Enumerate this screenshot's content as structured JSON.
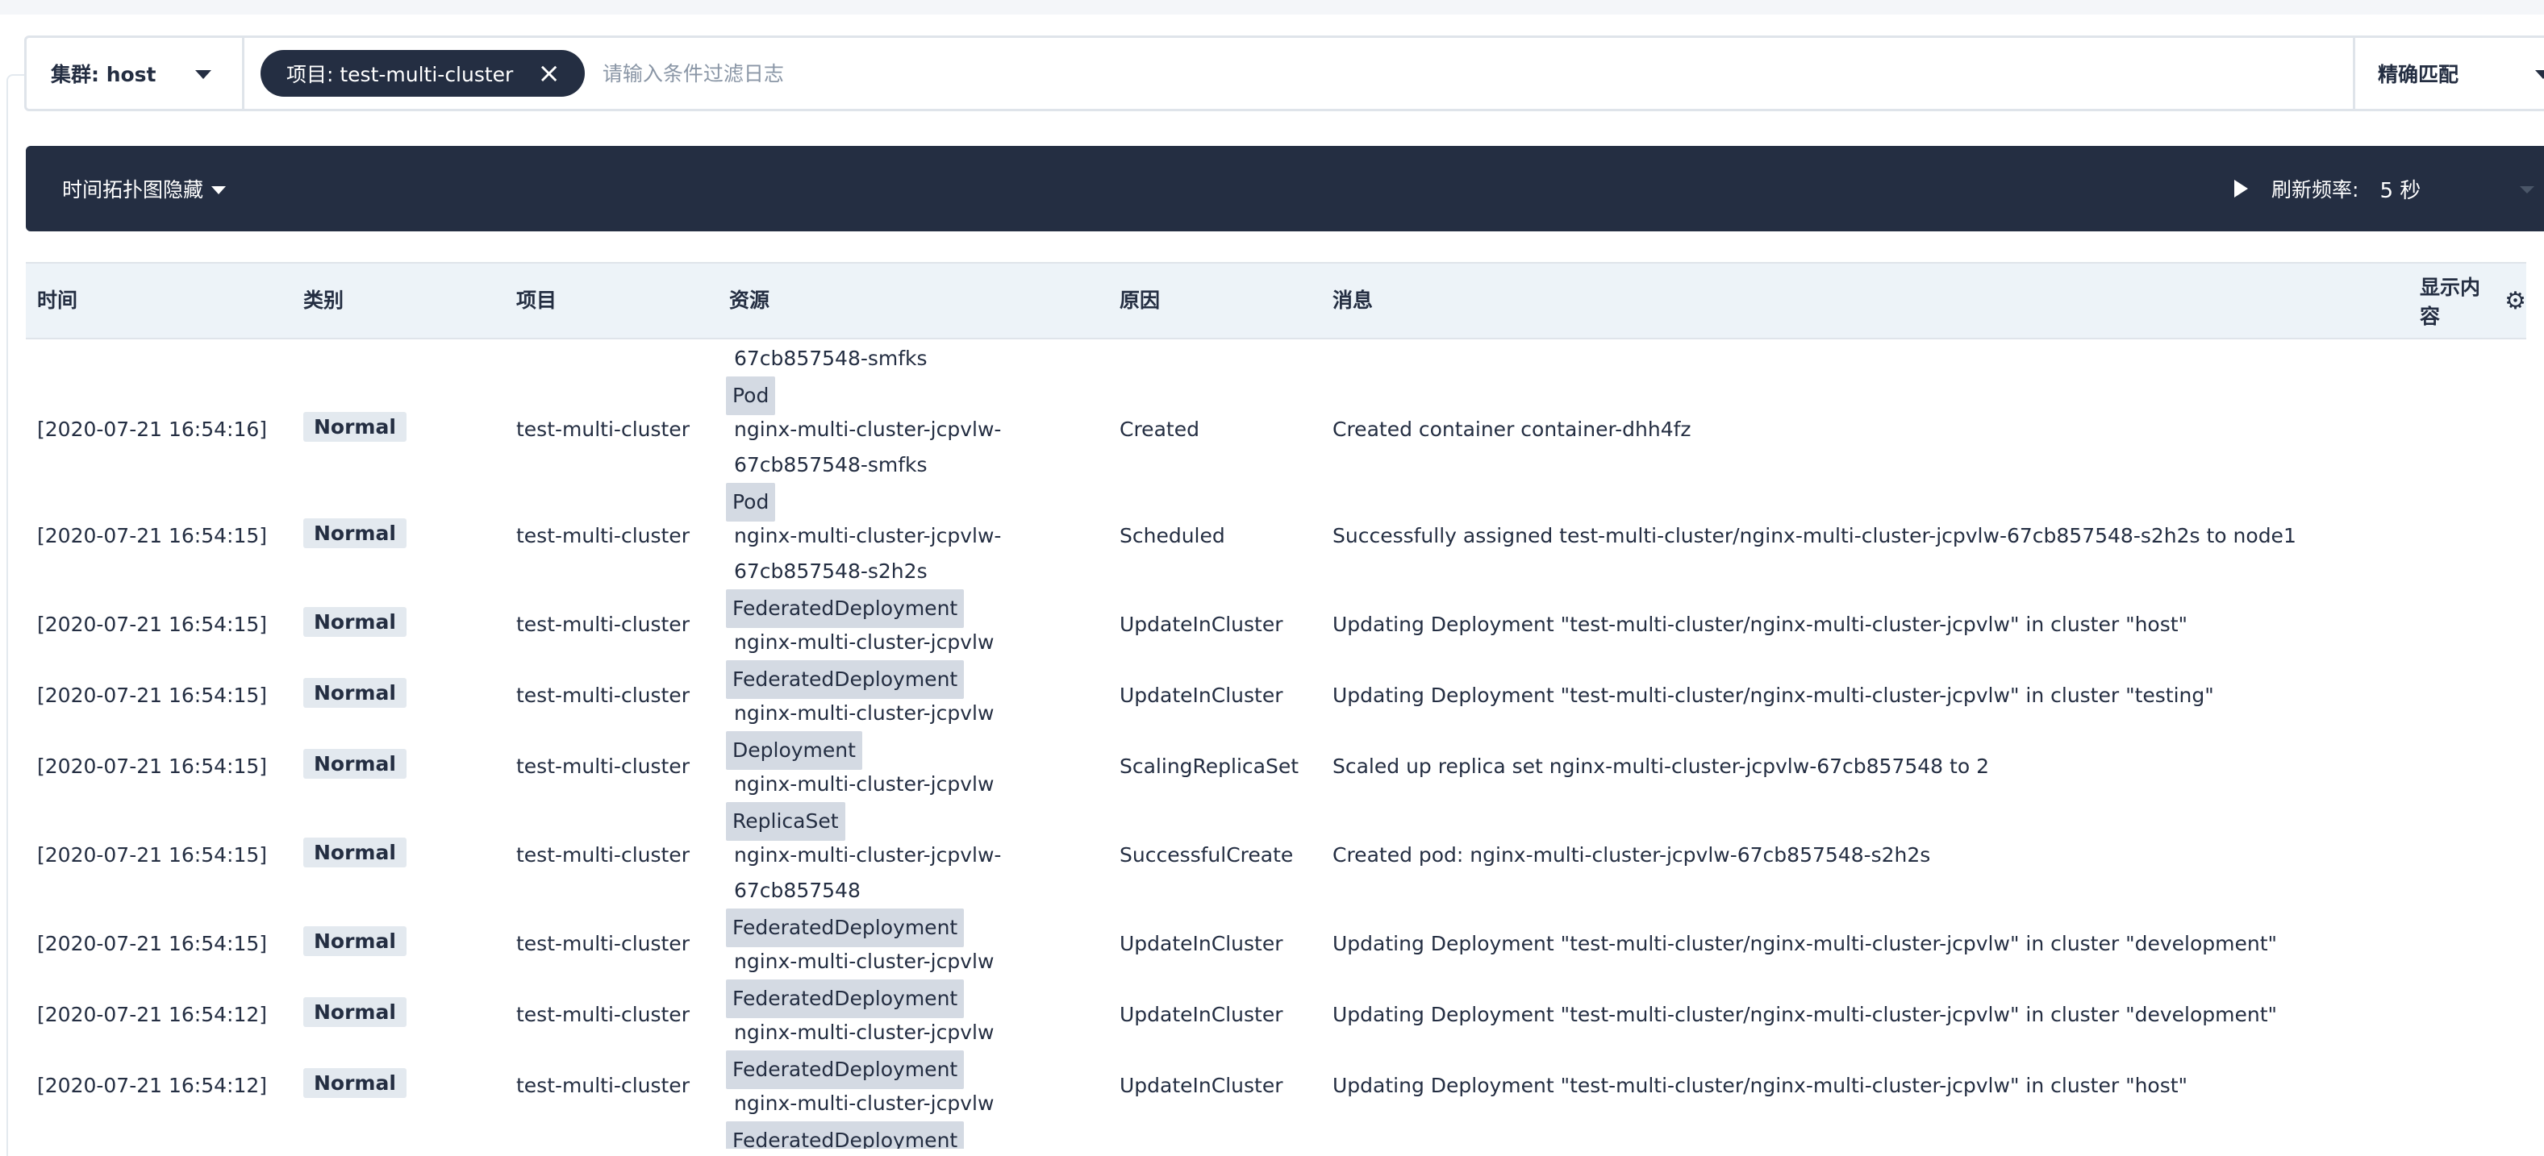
{
  "filter": {
    "cluster_label": "集群: host",
    "tag_label": "项目: test-multi-cluster",
    "search_placeholder": "请输入条件过滤日志",
    "match_mode": "精确匹配"
  },
  "toolbar": {
    "topology_toggle": "时间拓扑图隐藏",
    "refresh_label": "刷新频率:",
    "refresh_value": "5 秒"
  },
  "table": {
    "headers": [
      "时间",
      "类别",
      "项目",
      "资源",
      "原因",
      "消息"
    ],
    "display_content": "显示内容",
    "partial_top_row": {
      "resource_line": "67cb857548-smfks"
    },
    "rows": [
      {
        "time": "[2020-07-21 16:54:16]",
        "type": "Normal",
        "project": "test-multi-cluster",
        "kind": "Pod",
        "resource": [
          "nginx-multi-cluster-jcpvlw-",
          "67cb857548-smfks"
        ],
        "reason": "Created",
        "message": "Created container container-dhh4fz"
      },
      {
        "time": "[2020-07-21 16:54:15]",
        "type": "Normal",
        "project": "test-multi-cluster",
        "kind": "Pod",
        "resource": [
          "nginx-multi-cluster-jcpvlw-",
          "67cb857548-s2h2s"
        ],
        "reason": "Scheduled",
        "message": "Successfully assigned test-multi-cluster/nginx-multi-cluster-jcpvlw-67cb857548-s2h2s to node1"
      },
      {
        "time": "[2020-07-21 16:54:15]",
        "type": "Normal",
        "project": "test-multi-cluster",
        "kind": "FederatedDeployment",
        "resource": [
          "nginx-multi-cluster-jcpvlw"
        ],
        "reason": "UpdateInCluster",
        "message": "Updating Deployment \"test-multi-cluster/nginx-multi-cluster-jcpvlw\" in cluster \"host\""
      },
      {
        "time": "[2020-07-21 16:54:15]",
        "type": "Normal",
        "project": "test-multi-cluster",
        "kind": "FederatedDeployment",
        "resource": [
          "nginx-multi-cluster-jcpvlw"
        ],
        "reason": "UpdateInCluster",
        "message": "Updating Deployment \"test-multi-cluster/nginx-multi-cluster-jcpvlw\" in cluster \"testing\""
      },
      {
        "time": "[2020-07-21 16:54:15]",
        "type": "Normal",
        "project": "test-multi-cluster",
        "kind": "Deployment",
        "resource": [
          "nginx-multi-cluster-jcpvlw"
        ],
        "reason": "ScalingReplicaSet",
        "message": "Scaled up replica set nginx-multi-cluster-jcpvlw-67cb857548 to 2"
      },
      {
        "time": "[2020-07-21 16:54:15]",
        "type": "Normal",
        "project": "test-multi-cluster",
        "kind": "ReplicaSet",
        "resource": [
          "nginx-multi-cluster-jcpvlw-",
          "67cb857548"
        ],
        "reason": "SuccessfulCreate",
        "message": "Created pod: nginx-multi-cluster-jcpvlw-67cb857548-s2h2s"
      },
      {
        "time": "[2020-07-21 16:54:15]",
        "type": "Normal",
        "project": "test-multi-cluster",
        "kind": "FederatedDeployment",
        "resource": [
          "nginx-multi-cluster-jcpvlw"
        ],
        "reason": "UpdateInCluster",
        "message": "Updating Deployment \"test-multi-cluster/nginx-multi-cluster-jcpvlw\" in cluster \"development\""
      },
      {
        "time": "[2020-07-21 16:54:12]",
        "type": "Normal",
        "project": "test-multi-cluster",
        "kind": "FederatedDeployment",
        "resource": [
          "nginx-multi-cluster-jcpvlw"
        ],
        "reason": "UpdateInCluster",
        "message": "Updating Deployment \"test-multi-cluster/nginx-multi-cluster-jcpvlw\" in cluster \"development\""
      },
      {
        "time": "[2020-07-21 16:54:12]",
        "type": "Normal",
        "project": "test-multi-cluster",
        "kind": "FederatedDeployment",
        "resource": [
          "nginx-multi-cluster-jcpvlw"
        ],
        "reason": "UpdateInCluster",
        "message": "Updating Deployment \"test-multi-cluster/nginx-multi-cluster-jcpvlw\" in cluster \"host\""
      }
    ]
  }
}
